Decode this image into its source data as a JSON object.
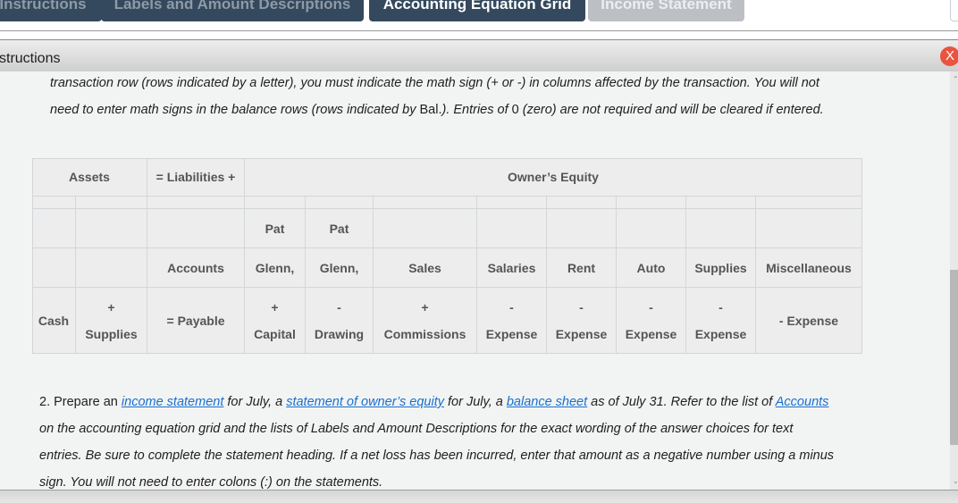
{
  "tabs": [
    {
      "label": "Instructions",
      "state": "dark"
    },
    {
      "label": "Labels and Amount Descriptions",
      "state": "dark"
    },
    {
      "label": "Accounting Equation Grid",
      "state": "active"
    },
    {
      "label": "Income Statement",
      "state": "disabled"
    }
  ],
  "panel": {
    "title": "structions",
    "close_label": "X"
  },
  "intro": {
    "line1": "transaction row (rows indicated by a letter), you must indicate the math sign (+ or -) in columns affected by the transaction. You will not",
    "line2_a": "need to enter math signs in the balance rows (rows indicated by ",
    "line2_b": "Bal.",
    "line2_c": "). Entries of ",
    "line2_d": "0",
    "line2_e": " (zero) are not required and will be cleared if entered."
  },
  "grid": {
    "group_headers": {
      "assets": "Assets",
      "liabilities": "= Liabilities +",
      "owners_equity": "Owner’s Equity"
    },
    "columns": [
      {
        "row1": "",
        "row2": "",
        "sign": "",
        "name": "Cash"
      },
      {
        "row1": "",
        "row2": "",
        "sign": "+",
        "name": "Supplies"
      },
      {
        "row1": "",
        "row2": "Accounts",
        "sign": "",
        "name": "= Payable"
      },
      {
        "row1": "Pat",
        "row2": "Glenn,",
        "sign": "+",
        "name": "Capital"
      },
      {
        "row1": "Pat",
        "row2": "Glenn,",
        "sign": "-",
        "name": "Drawing"
      },
      {
        "row1": "",
        "row2": "Sales",
        "sign": "+",
        "name": "Commissions"
      },
      {
        "row1": "",
        "row2": "Salaries",
        "sign": "-",
        "name": "Expense"
      },
      {
        "row1": "",
        "row2": "Rent",
        "sign": "-",
        "name": "Expense"
      },
      {
        "row1": "",
        "row2": "Auto",
        "sign": "-",
        "name": "Expense"
      },
      {
        "row1": "",
        "row2": "Supplies",
        "sign": "-",
        "name": "Expense"
      },
      {
        "row1": "",
        "row2": "Miscellaneous",
        "sign": "",
        "name": "- Expense"
      }
    ]
  },
  "step2": {
    "prefix": "2. Prepare an ",
    "link_income": "income statement",
    "mid1": " for July, a ",
    "link_equity": "statement of owner’s equity",
    "mid2": " for July, a ",
    "link_balance": "balance sheet",
    "mid3": " as of July 31. Refer to the list of ",
    "link_accounts": "Accounts",
    "line2": " on the accounting equation grid and the lists of Labels and Amount Descriptions for the exact wording of the answer choices for text",
    "line3": "entries. Be sure to complete the statement heading. If a net loss has been incurred, enter that amount as a negative number using a minus",
    "line4": "sign. You will not need to enter colons (:) on the statements."
  }
}
